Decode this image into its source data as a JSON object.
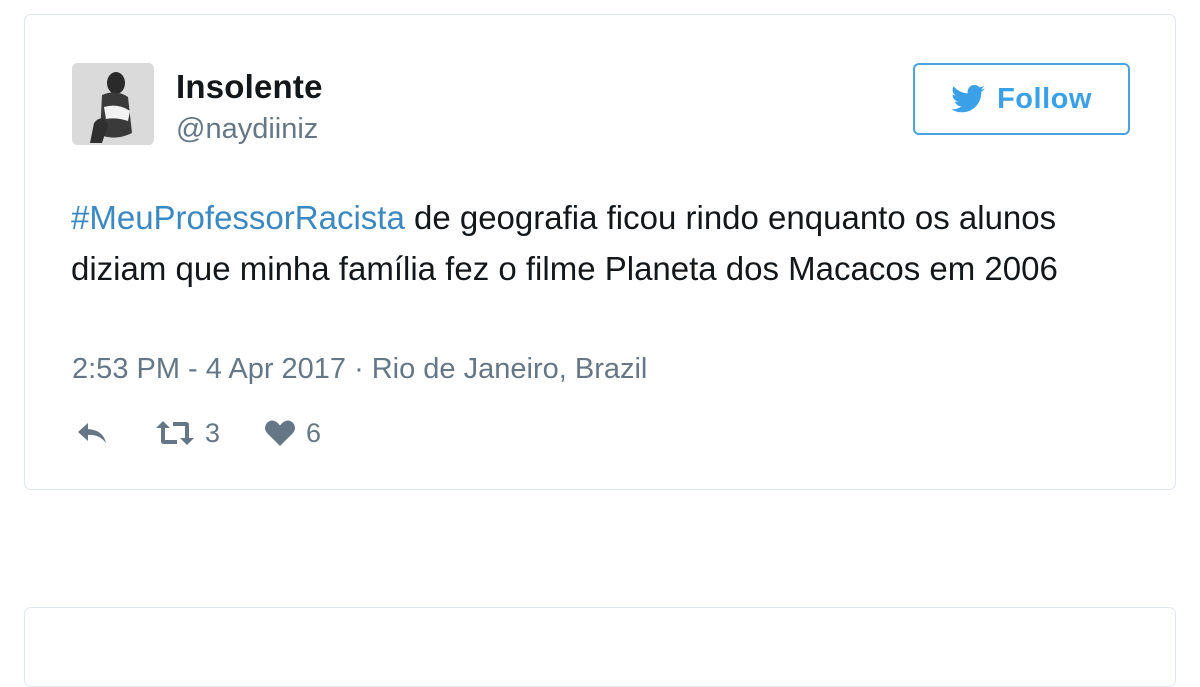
{
  "tweet": {
    "author": {
      "display_name": "Insolente",
      "handle": "@naydiiniz"
    },
    "follow_label": "Follow",
    "text": {
      "hashtag": "#MeuProfessorRacista",
      "body": " de geografia ficou rindo enquanto os alunos diziam que minha família fez o filme Planeta dos Macacos em 2006"
    },
    "timestamp": "2:53 PM - 4 Apr 2017",
    "separator": "·",
    "location": "Rio de Janeiro, Brazil",
    "retweet_count": "3",
    "like_count": "6"
  },
  "colors": {
    "accent": "#1da1f2",
    "hashtag": "#3b88c3",
    "muted": "#657786",
    "border": "#e1e8ed"
  },
  "icons": {
    "reply": "reply-icon",
    "retweet": "retweet-icon",
    "like": "heart-icon",
    "follow": "twitter-bird-icon"
  }
}
